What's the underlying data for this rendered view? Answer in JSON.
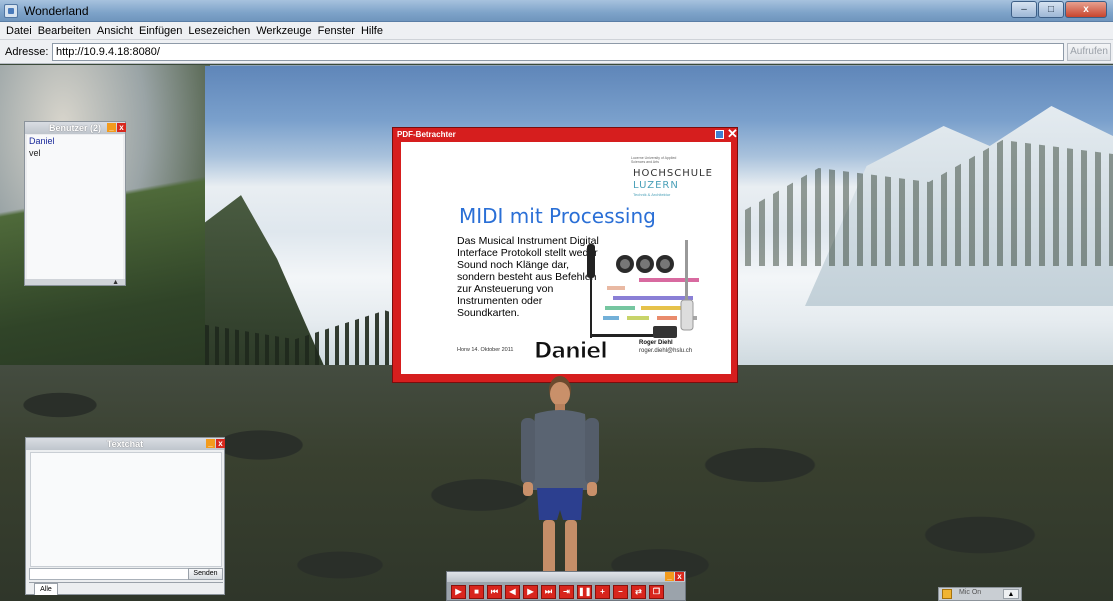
{
  "window": {
    "title": "Wonderland",
    "min": "–",
    "max": "□",
    "close": "x"
  },
  "menu": {
    "items": [
      "Datei",
      "Bearbeiten",
      "Ansicht",
      "Einfügen",
      "Lesezeichen",
      "Werkzeuge",
      "Fenster",
      "Hilfe"
    ]
  },
  "address": {
    "label": "Adresse:",
    "value": "http://10.9.4.18:8080/",
    "go_label": "Aufrufen"
  },
  "users": {
    "title": "Benutzer (2)",
    "items": [
      "Daniel",
      "vel"
    ],
    "min": "_",
    "close": "x",
    "scroll": "▲"
  },
  "chat": {
    "title": "Textchat",
    "send_label": "Senden",
    "tab_label": "Alle",
    "min": "_",
    "close": "x"
  },
  "pdf": {
    "title": "PDF-Betrachter",
    "close": "✕",
    "uni_small": "Lucerne University of Applied Sciences and Arts",
    "uni_name1": "HOCHSCHULE",
    "uni_name2": "LUZERN",
    "uni_dept": "Technik & Architektur",
    "slide_title": "MIDI mit Processing",
    "slide_body": "Das Musical Instrument Digital Interface Protokoll stellt weder Sound noch Klänge dar, sondern besteht aus Befehlen zur Ansteuerung von Instrumenten oder Soundkarten.",
    "date": "Horw  14. Oktober 2011",
    "author": "Roger Diehl",
    "email": "roger.diehl@hslu.ch"
  },
  "avatar_name": "Daniel",
  "media": {
    "min": "_",
    "close": "x",
    "buttons": [
      "▶",
      "■",
      "⏮",
      "◀",
      "▶",
      "⏭",
      "⇥",
      "❚❚",
      "+",
      "–",
      "⇄",
      "❐"
    ]
  },
  "status": {
    "text": "Mic On",
    "arrow": "▲"
  },
  "colors": {
    "accent_red": "#d61e1e",
    "title_blue": "#2a6fd6",
    "hslu_teal": "#4aa0b8"
  }
}
